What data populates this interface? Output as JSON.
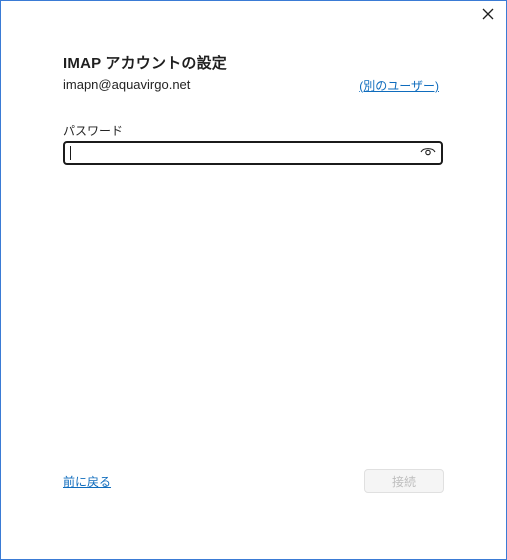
{
  "dialog": {
    "title": "IMAP アカウントの設定",
    "email": "imapn@aquavirgo.net",
    "other_user_link": "(別のユーザー)",
    "password_label": "パスワード",
    "password_value": "",
    "back_link": "前に戻る",
    "connect_label": "接続"
  },
  "icons": {
    "close": "close-icon",
    "reveal_password": "eye-icon"
  },
  "colors": {
    "accent": "#0f6cbd",
    "window_border": "#3a7bd5",
    "disabled_text": "#bdbdbd"
  }
}
